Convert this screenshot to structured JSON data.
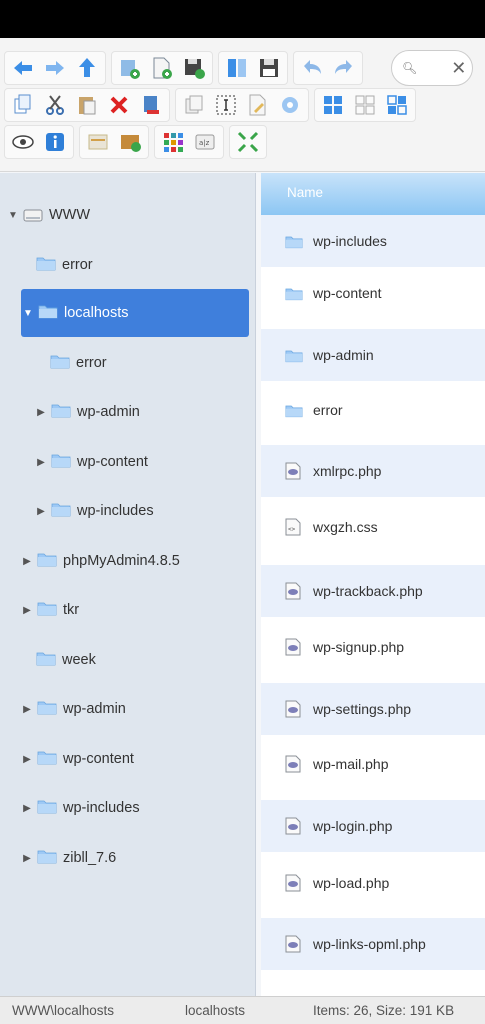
{
  "colors": {
    "accent": "#3f7fdc",
    "header_gradient": "#8cc6f3",
    "tree_bg": "#dfe6ee",
    "alt_row": "#e9f0fb"
  },
  "toolbar": {
    "search": {
      "placeholder": "",
      "icon": "search-icon",
      "clear_icon": "close-icon"
    },
    "row1": [
      [
        "back-icon",
        "forward-icon",
        "up-icon"
      ],
      [
        "new-folder-icon",
        "new-file-icon",
        "save-as-icon"
      ],
      [
        "split-view-icon",
        "save-icon"
      ],
      [
        "undo-icon",
        "redo-icon"
      ]
    ],
    "row2": [
      [
        "copy-icon",
        "cut-icon",
        "paste-icon",
        "delete-icon",
        "rename-icon"
      ],
      [
        "duplicate-icon",
        "select-icon",
        "edit-icon",
        "properties-icon"
      ],
      [
        "large-icons-view-icon",
        "small-icons-view-icon",
        "list-view-icon"
      ]
    ],
    "row3": [
      [
        "preview-icon",
        "info-icon"
      ],
      [
        "archive-icon",
        "extract-icon"
      ],
      [
        "grid-view-icon",
        "sort-icon"
      ],
      [
        "fullscreen-icon"
      ]
    ]
  },
  "tree": {
    "root": "WWW",
    "items": [
      {
        "label": "error",
        "arrow": ""
      },
      {
        "label": "localhosts",
        "arrow": "▼",
        "selected": true
      },
      {
        "label": "error",
        "arrow": ""
      },
      {
        "label": "wp-admin",
        "arrow": "▶"
      },
      {
        "label": "wp-content",
        "arrow": "▶"
      },
      {
        "label": "wp-includes",
        "arrow": "▶"
      },
      {
        "label": "phpMyAdmin4.8.5",
        "arrow": "▶"
      },
      {
        "label": "tkr",
        "arrow": "▶"
      },
      {
        "label": "week",
        "arrow": ""
      },
      {
        "label": "wp-admin",
        "arrow": "▶"
      },
      {
        "label": "wp-content",
        "arrow": "▶"
      },
      {
        "label": "wp-includes",
        "arrow": "▶"
      },
      {
        "label": "zibll_7.6",
        "arrow": "▶"
      }
    ]
  },
  "list": {
    "header": "Name",
    "rows": [
      {
        "name": "wp-includes",
        "type": "folder"
      },
      {
        "name": "wp-content",
        "type": "folder"
      },
      {
        "name": "wp-admin",
        "type": "folder"
      },
      {
        "name": "error",
        "type": "folder"
      },
      {
        "name": "xmlrpc.php",
        "type": "php"
      },
      {
        "name": "wxgzh.css",
        "type": "css"
      },
      {
        "name": "wp-trackback.php",
        "type": "php"
      },
      {
        "name": "wp-signup.php",
        "type": "php"
      },
      {
        "name": "wp-settings.php",
        "type": "php"
      },
      {
        "name": "wp-mail.php",
        "type": "php"
      },
      {
        "name": "wp-login.php",
        "type": "php"
      },
      {
        "name": "wp-load.php",
        "type": "php"
      },
      {
        "name": "wp-links-opml.php",
        "type": "php"
      }
    ]
  },
  "status": {
    "path": "WWW\\localhosts",
    "current": "localhosts",
    "summary": "Items: 26, Size: 191 KB"
  }
}
